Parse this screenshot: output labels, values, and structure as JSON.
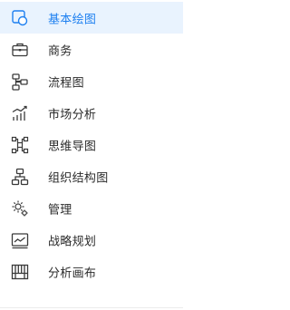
{
  "menu": {
    "items": [
      {
        "label": "基本绘图",
        "icon": "shape-icon",
        "active": true
      },
      {
        "label": "商务",
        "icon": "briefcase-icon",
        "active": false
      },
      {
        "label": "流程图",
        "icon": "flowchart-icon",
        "active": false
      },
      {
        "label": "市场分析",
        "icon": "bar-chart-icon",
        "active": false
      },
      {
        "label": "思维导图",
        "icon": "mindmap-icon",
        "active": false
      },
      {
        "label": "组织结构图",
        "icon": "org-chart-icon",
        "active": false
      },
      {
        "label": "管理",
        "icon": "management-gear-icon",
        "active": false
      },
      {
        "label": "战略规划",
        "icon": "strategy-window-icon",
        "active": false
      },
      {
        "label": "分析画布",
        "icon": "canvas-grid-icon",
        "active": false
      }
    ]
  },
  "colors": {
    "accent": "#1e80f0",
    "active_bg": "#e9f3fe",
    "text": "#2b2b2b",
    "icon": "#3a3a3a"
  }
}
